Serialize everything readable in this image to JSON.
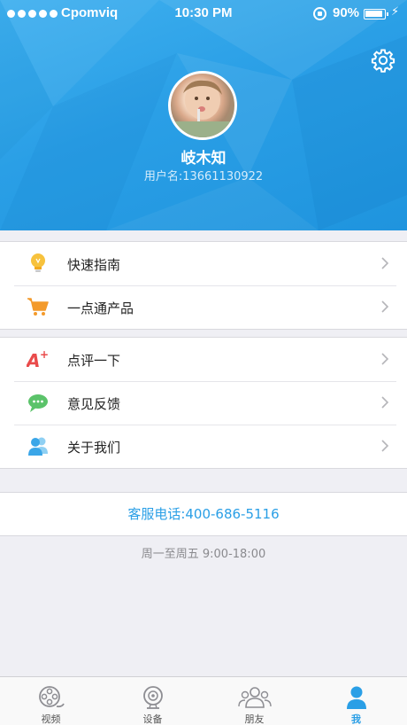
{
  "status_bar": {
    "carrier": "Cpomviq",
    "time": "10:30 PM",
    "battery": "90%"
  },
  "profile": {
    "nickname": "岐木知",
    "account": "用户名:13661130922"
  },
  "menu_group_1": [
    {
      "label": "快速指南",
      "icon": "lightbulb-icon"
    },
    {
      "label": "一点通产品",
      "icon": "cart-icon"
    }
  ],
  "menu_group_2": [
    {
      "label": "点评一下",
      "icon": "a-plus-icon"
    },
    {
      "label": "意见反馈",
      "icon": "chat-bubble-icon"
    },
    {
      "label": "关于我们",
      "icon": "people-icon"
    }
  ],
  "service": {
    "phone": "客服电话:400-686-5116",
    "hours": "周一至周五 9:00-18:00"
  },
  "tabs": [
    {
      "label": "视频",
      "icon": "film-reel-icon"
    },
    {
      "label": "设备",
      "icon": "camera-icon"
    },
    {
      "label": "朋友",
      "icon": "friends-icon"
    },
    {
      "label": "我",
      "icon": "person-icon",
      "active": true
    }
  ],
  "colors": {
    "accent": "#2a9fe6",
    "header": "#2ea3ea",
    "background": "#efeff4"
  }
}
